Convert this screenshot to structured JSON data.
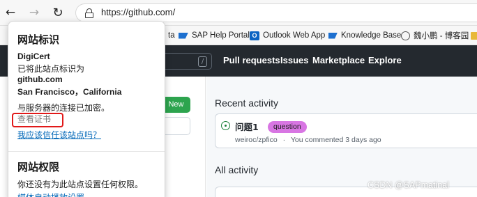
{
  "browser": {
    "address_url": "https://github.com/",
    "nav_icons": [
      "back-arrow-icon",
      "forward-arrow-icon",
      "reload-icon",
      "lock-icon"
    ]
  },
  "bookmarks": [
    {
      "label": "ta",
      "icon": "folder-icon"
    },
    {
      "label": "SAP Help Portal",
      "icon": "sap-icon"
    },
    {
      "label": "Outlook Web App",
      "icon": "outlook-icon"
    },
    {
      "label": "Knowledge Base",
      "icon": "sap-icon"
    },
    {
      "label": "魏小鹏 - 博客园",
      "icon": "blog-icon"
    }
  ],
  "github": {
    "search_key": "/",
    "nav": [
      "Pull requests",
      "Issues",
      "Marketplace",
      "Explore"
    ],
    "new_button": "New",
    "recent_activity_title": "Recent activity",
    "issue_title": "问题1",
    "issue_label": "question",
    "issue_repo": "weiroc/zpfico",
    "issue_sep": "·",
    "issue_time": "You commented 3 days ago",
    "all_activity_title": "All activity",
    "colors": {
      "header_bg": "#24292f",
      "new_button": "#2da44e",
      "label_question": "#d876e3",
      "issue_open": "#1a7f37"
    }
  },
  "popup": {
    "site_id_title": "网站标识",
    "org": "DigiCert",
    "identified_as": "已将此站点标识为",
    "domain": "github.com",
    "location": "San Francisco，California",
    "encrypted": "与服务器的连接已加密。",
    "view_cert": "查看证书",
    "trust_link": "我应该信任该站点吗？",
    "permissions_title": "网站权限",
    "no_permissions": "你还没有为此站点设置任何权限。",
    "media_link": "媒体自动播放设置",
    "highlight_color": "#e11919"
  },
  "watermark": "CSDN @SAPmatinal"
}
